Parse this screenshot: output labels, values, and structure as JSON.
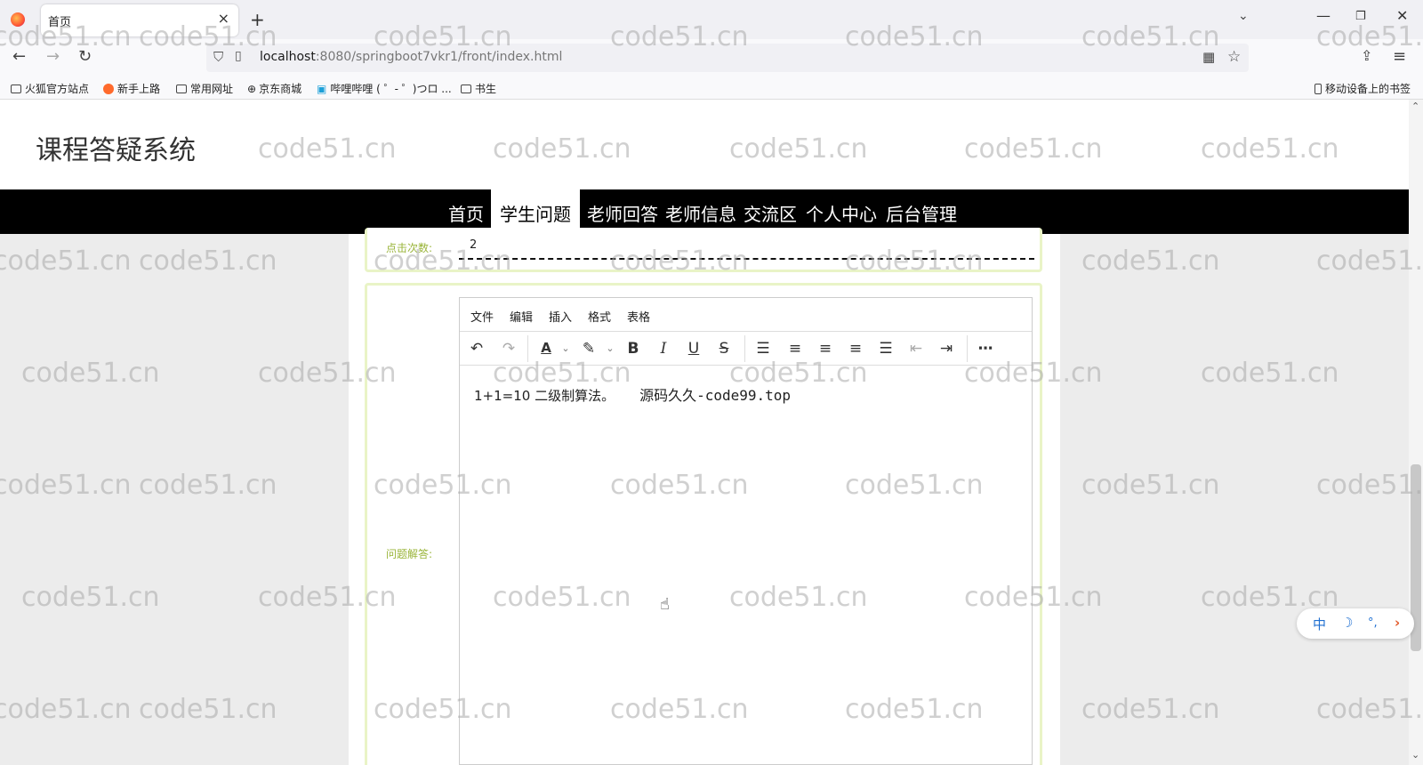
{
  "browser": {
    "tab_title": "首页",
    "url_host": "localhost",
    "url_rest": ":8080/springboot7vkr1/front/index.html",
    "bookmarks": [
      "火狐官方站点",
      "新手上路",
      "常用网址",
      "京东商城",
      "哔哩哔哩 ( ゜- ゜)つロ ...",
      "书生"
    ],
    "mobile_bookmarks": "移动设备上的书签"
  },
  "site": {
    "title": "课程答疑系统",
    "nav": [
      "首页",
      "学生问题",
      "老师回答",
      "老师信息",
      "交流区",
      "个人中心",
      "后台管理"
    ],
    "active_nav": "学生问题"
  },
  "form": {
    "clicks_label": "点击次数:",
    "clicks_value": "2",
    "answer_label": "问题解答:"
  },
  "editor": {
    "menus": [
      "文件",
      "编辑",
      "插入",
      "格式",
      "表格"
    ],
    "content_text": "1+1=10 二级制算法。",
    "content_mono": "源码久久-code99.top"
  },
  "floater": {
    "lang": "中"
  },
  "watermark": "code51.cn"
}
